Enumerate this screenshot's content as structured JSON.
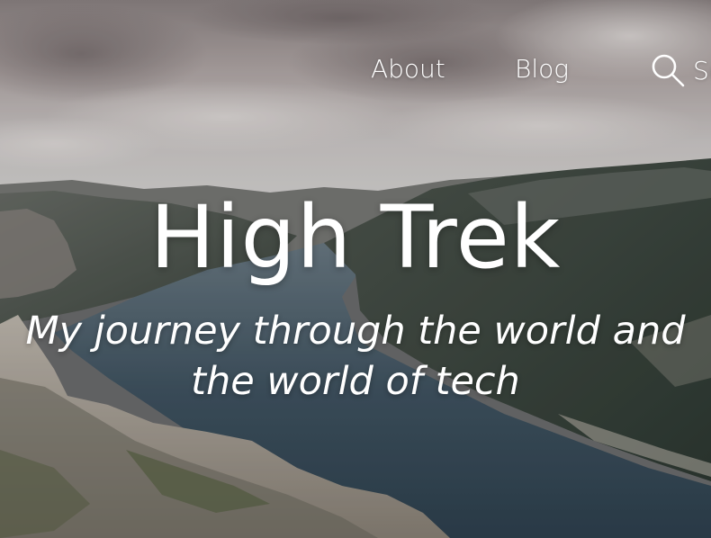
{
  "nav": {
    "about_label": "About",
    "blog_label": "Blog",
    "search_label": "Search"
  },
  "hero": {
    "title": "High Trek",
    "tagline": "My journey through the world and the world of tech"
  },
  "colors": {
    "text": "#ffffff",
    "sky": "#cfc9c8",
    "mountains": "#3e4640",
    "water": "#40535f",
    "rock": "#b9b2a8"
  }
}
